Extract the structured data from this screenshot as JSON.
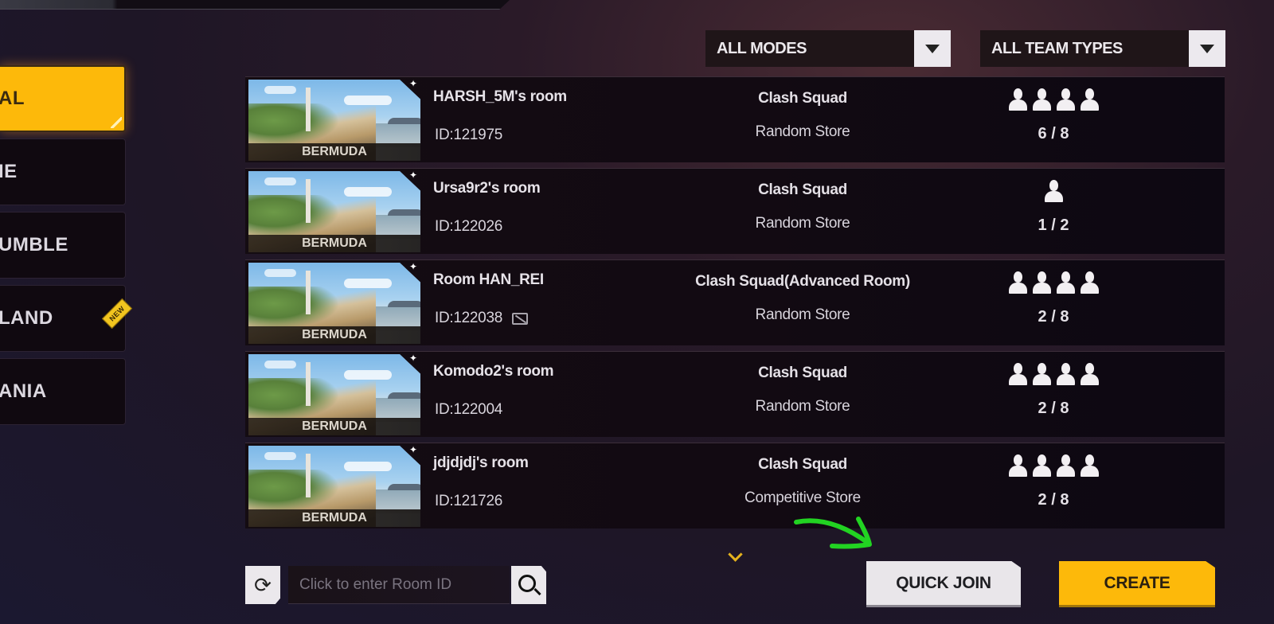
{
  "sidebar": {
    "items": [
      {
        "label": "AL",
        "active": true,
        "badge": null
      },
      {
        "label": "IE",
        "active": false,
        "badge": null
      },
      {
        "label": "UMBLE",
        "active": false,
        "badge": null
      },
      {
        "label": "LAND",
        "active": false,
        "badge": "NEW"
      },
      {
        "label": "ANIA",
        "active": false,
        "badge": null
      }
    ]
  },
  "filters": {
    "mode": {
      "selected": "ALL MODES"
    },
    "team_type": {
      "selected": "ALL TEAM TYPES"
    }
  },
  "rooms": [
    {
      "map": "BERMUDA",
      "name": "HARSH_5M's room",
      "id": "ID:121975",
      "mode": "Clash Squad",
      "store": "Random Store",
      "player_icons": 4,
      "count": "6 / 8",
      "spectate_icon": false
    },
    {
      "map": "BERMUDA",
      "name": "Ursa9r2's room",
      "id": "ID:122026",
      "mode": "Clash Squad",
      "store": "Random Store",
      "player_icons": 1,
      "count": "1 / 2",
      "spectate_icon": false
    },
    {
      "map": "BERMUDA",
      "name": "Room HAN_REI",
      "id": "ID:122038",
      "mode": "Clash Squad(Advanced Room)",
      "store": "Random Store",
      "player_icons": 4,
      "count": "2 / 8",
      "spectate_icon": true
    },
    {
      "map": "BERMUDA",
      "name": "Komodo2's room",
      "id": "ID:122004",
      "mode": "Clash Squad",
      "store": "Random Store",
      "player_icons": 4,
      "count": "2 / 8",
      "spectate_icon": false
    },
    {
      "map": "BERMUDA",
      "name": "jdjdjdj's room",
      "id": "ID:121726",
      "mode": "Clash Squad",
      "store": "Competitive Store",
      "player_icons": 4,
      "count": "2 / 8",
      "spectate_icon": false
    }
  ],
  "bottom": {
    "room_id_placeholder": "Click to enter Room ID",
    "quick_join_label": "QUICK JOIN",
    "create_label": "CREATE",
    "refresh_icon": "⟳"
  },
  "colors": {
    "accent": "#fdb90a",
    "annotation": "#22d322"
  }
}
